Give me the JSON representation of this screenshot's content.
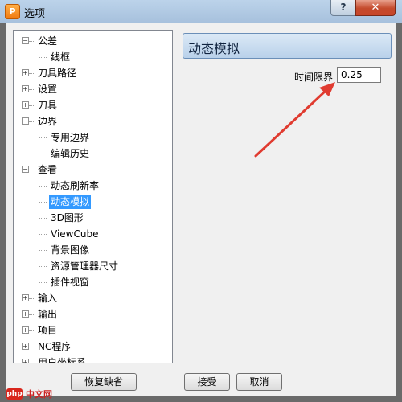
{
  "window": {
    "title": "选项",
    "app_icon_letter": "P",
    "help_label": "?",
    "close_label": "✕"
  },
  "tree": {
    "items": [
      {
        "label": "公差",
        "expander": "−"
      },
      {
        "label": "线框"
      },
      {
        "label": "刀具路径",
        "expander": "+"
      },
      {
        "label": "设置",
        "expander": "+"
      },
      {
        "label": "刀具",
        "expander": "+"
      },
      {
        "label": "边界",
        "expander": "−"
      },
      {
        "label": "专用边界"
      },
      {
        "label": "编辑历史"
      },
      {
        "label": "查看",
        "expander": "−"
      },
      {
        "label": "动态刷新率"
      },
      {
        "label": "动态模拟",
        "selected": true
      },
      {
        "label": "3D图形"
      },
      {
        "label": "ViewCube"
      },
      {
        "label": "背景图像"
      },
      {
        "label": "资源管理器尺寸"
      },
      {
        "label": "插件视窗"
      },
      {
        "label": "输入",
        "expander": "+"
      },
      {
        "label": "输出",
        "expander": "+"
      },
      {
        "label": "项目",
        "expander": "+"
      },
      {
        "label": "NC程序",
        "expander": "+"
      },
      {
        "label": "用户坐标系",
        "expander": "+"
      }
    ]
  },
  "panel": {
    "title": "动态模拟",
    "field_label": "时间限界",
    "field_value": "0.25"
  },
  "buttons": {
    "restore_defaults": "恢复缺省",
    "accept": "接受",
    "cancel": "取消"
  },
  "watermark": {
    "logo": "php",
    "text": "中文网"
  },
  "colors": {
    "selection": "#3399ff",
    "annotation_arrow": "#e03b30",
    "close_button": "#c7462a"
  }
}
